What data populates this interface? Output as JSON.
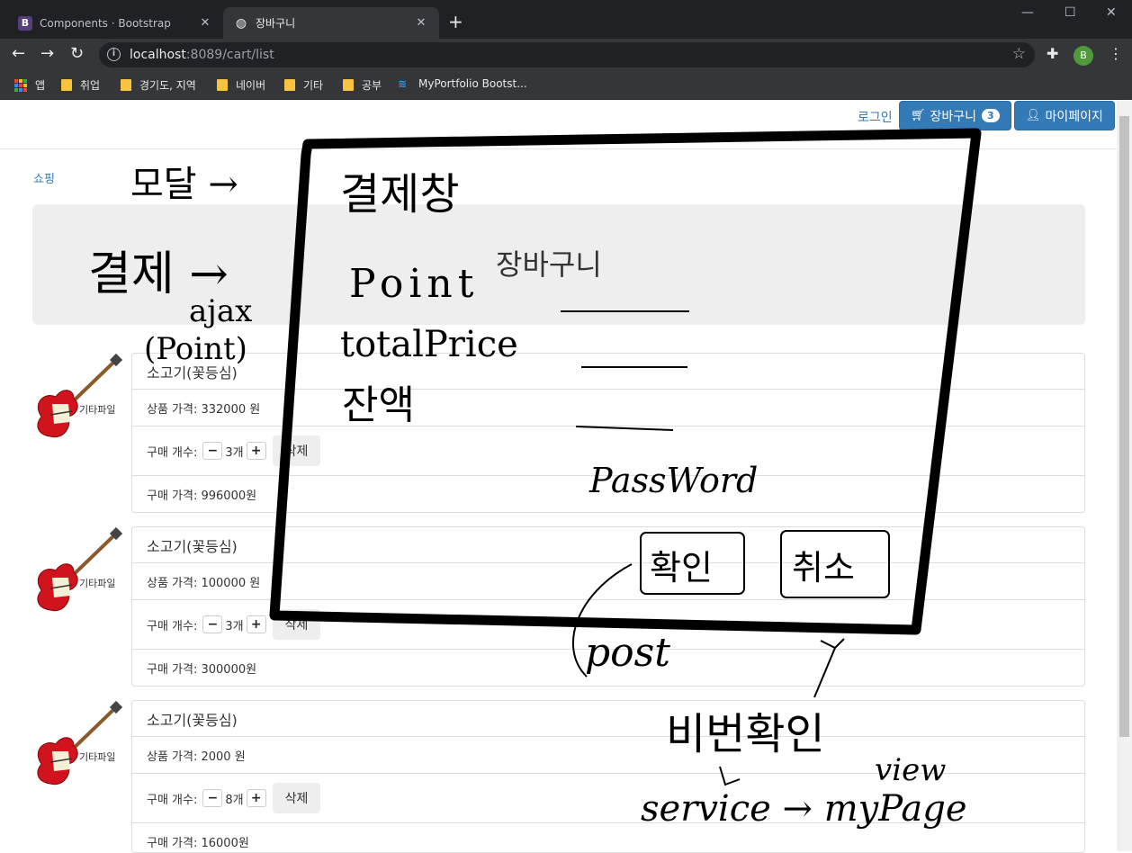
{
  "browser": {
    "tabs": [
      {
        "title": "Components · Bootstrap",
        "favicon": "bootstrap-icon"
      },
      {
        "title": "장바구니",
        "favicon": "globe-icon"
      }
    ],
    "url_host": "localhost",
    "url_rest": ":8089/cart/list",
    "profile_initial": "B",
    "bookmarks": [
      {
        "label": "앱",
        "icon": "apps-icon"
      },
      {
        "label": "취업",
        "icon": "folder-icon"
      },
      {
        "label": "경기도, 지역",
        "icon": "folder-icon"
      },
      {
        "label": "네이버",
        "icon": "folder-icon"
      },
      {
        "label": "기타",
        "icon": "folder-icon"
      },
      {
        "label": "공부",
        "icon": "folder-icon"
      },
      {
        "label": "MyPortfolio Bootst...",
        "icon": "bootstrap-blue-icon"
      }
    ]
  },
  "nav": {
    "login": "로그인",
    "cart_label": "장바구니",
    "cart_count": "3",
    "mypage_label": "마이페이지"
  },
  "breadcrumb": "쇼핑",
  "jumbotron_title": "장바구니",
  "items": [
    {
      "thumb_label": "기타파일",
      "name": "소고기(꽃등심)",
      "price": "상품 가격: 332000 원",
      "qty_label": "구매 개수:",
      "qty": "3개",
      "delete": "삭제",
      "total": "구매 가격: 996000원"
    },
    {
      "thumb_label": "기타파일",
      "name": "소고기(꽃등심)",
      "price": "상품 가격: 100000 원",
      "qty_label": "구매 개수:",
      "qty": "3개",
      "delete": "삭제",
      "total": "구매 가격: 300000원"
    },
    {
      "thumb_label": "기타파일",
      "name": "소고기(꽃등심)",
      "price": "상품 가격: 2000 원",
      "qty_label": "구매 개수:",
      "qty": "8개",
      "delete": "삭제",
      "total": "구매 가격: 16000원"
    }
  ],
  "handwriting": {
    "modal_note": "모달 →",
    "payment_window": "결제창",
    "payment_arrow": "결제 →",
    "ajax": "ajax",
    "point_paren": "(Point)",
    "point": "Point",
    "total_price": "totalPrice",
    "balance": "잔액",
    "password": "PassWord",
    "confirm": "확인",
    "cancel": "취소",
    "post": "post",
    "pw_check": "비번확인",
    "view": "view",
    "service_flow": "service → myPage"
  },
  "colors": {
    "primary": "#337ab7",
    "jumbotron": "#eeeeee",
    "chrome_dark": "#202124",
    "chrome_toolbar": "#35363a"
  }
}
